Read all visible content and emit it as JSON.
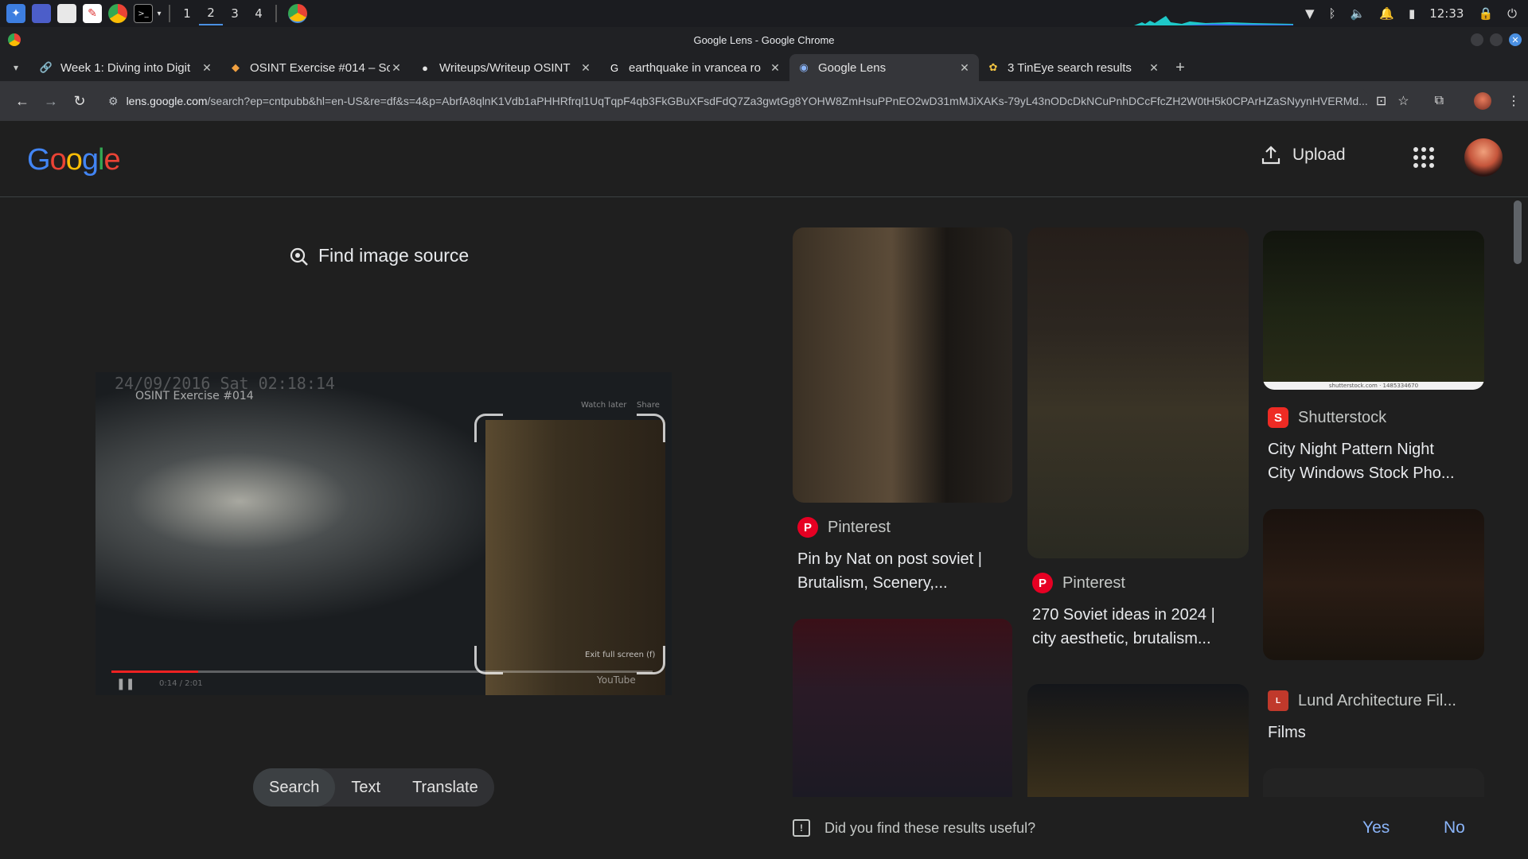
{
  "taskbar": {
    "workspaces": [
      "1",
      "2",
      "3",
      "4"
    ],
    "clock": "12:33"
  },
  "window": {
    "title": "Google Lens - Google Chrome"
  },
  "tabs": [
    {
      "label": "Week 1: Diving into Digit",
      "icon": "link-icon"
    },
    {
      "label": "OSINT Exercise #014 – So",
      "icon": "osint-icon"
    },
    {
      "label": "Writeups/Writeup OSINT",
      "icon": "github-icon"
    },
    {
      "label": "earthquake in vrancea ro",
      "icon": "google-icon"
    },
    {
      "label": "Google Lens",
      "icon": "lens-icon"
    },
    {
      "label": "3 TinEye search results",
      "icon": "tineye-icon"
    }
  ],
  "address": {
    "host": "lens.google.com",
    "path": "/search?ep=cntpubb&hl=en-US&re=df&s=4&p=AbrfA8qlnK1Vdb1aPHHRfrql1UqTqpF4qb3FkGBuXFsdFdQ7Za3gwtGg8YOHW8ZmHsuPPnEO2wD31mMJiXAKs-79yL43nODcDkNCuPnhDCcFfcZH2W0tH5k0CPArHZaSNyynHVERMd..."
  },
  "header": {
    "logo": "Google",
    "upload_label": "Upload"
  },
  "left": {
    "find_source": "Find image source",
    "query_image": {
      "timestamp": "24/09/2016 Sat 02:18:14",
      "video_title": "OSINT Exercise #014",
      "watch_later": "Watch later",
      "share": "Share",
      "exit_fullscreen": "Exit full screen (f)",
      "time": "0:14 / 2:01",
      "youtube": "YouTube"
    },
    "modes": [
      "Search",
      "Text",
      "Translate"
    ]
  },
  "results": [
    {
      "source": "Pinterest",
      "title_line1": "Pin by Nat on post soviet |",
      "title_line2": "Brutalism, Scenery,..."
    },
    {
      "source": "Pinterest",
      "title_line1": "270 Soviet ideas in 2024 |",
      "title_line2": "city aesthetic, brutalism..."
    },
    {
      "source": "Shutterstock",
      "title_line1": "City Night Pattern Night",
      "title_line2": "City Windows Stock Pho...",
      "watermark": "shutterstock.com · 1485334670"
    },
    {
      "source": "Lund Architecture Fil...",
      "title_line1": "Films",
      "title_line2": ""
    }
  ],
  "feedback": {
    "question": "Did you find these results useful?",
    "yes": "Yes",
    "no": "No"
  }
}
